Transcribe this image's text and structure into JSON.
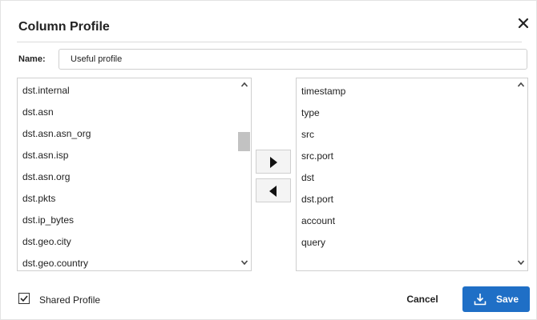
{
  "dialog": {
    "title": "Column Profile",
    "close_icon": "close-icon"
  },
  "name_field": {
    "label": "Name:",
    "value": "Useful profile"
  },
  "available_columns": [
    "dst.internal",
    "dst.asn",
    "dst.asn.asn_org",
    "dst.asn.isp",
    "dst.asn.org",
    "dst.pkts",
    "dst.ip_bytes",
    "dst.geo.city",
    "dst.geo.country"
  ],
  "selected_columns": [
    "timestamp",
    "type",
    "src",
    "src.port",
    "dst",
    "dst.port",
    "account",
    "query"
  ],
  "move_buttons": {
    "right_icon": "triangle-right-icon",
    "left_icon": "triangle-left-icon"
  },
  "footer": {
    "shared_label": "Shared Profile",
    "shared_checked": true,
    "cancel_label": "Cancel",
    "save_label": "Save",
    "save_icon": "download-icon"
  },
  "colors": {
    "accent": "#1f6fc6",
    "border": "#cfcfcf",
    "scroll_thumb": "#c2c2c2"
  }
}
